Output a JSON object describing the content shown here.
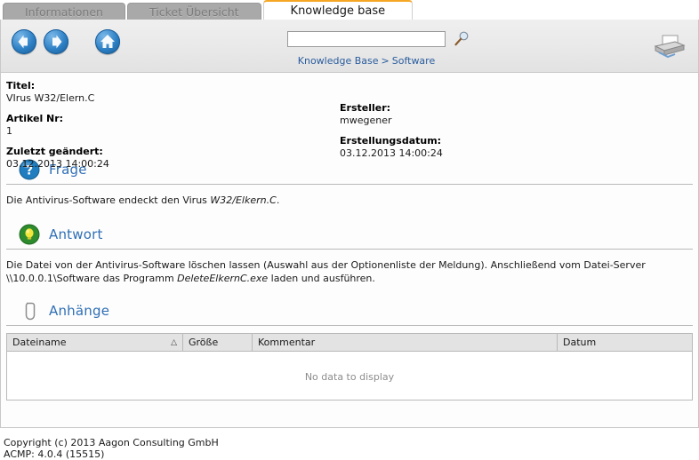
{
  "tabs": [
    {
      "label": "Informationen",
      "active": false
    },
    {
      "label": "Ticket Übersicht",
      "active": false
    },
    {
      "label": "Knowledge base",
      "active": true
    }
  ],
  "toolbar": {
    "back_label": "Zurück",
    "forward_label": "Vorwärts",
    "home_label": "Startseite",
    "print_label": "Drucken",
    "search_value": "",
    "search_placeholder": "",
    "search_button_label": "Suchen",
    "breadcrumb": {
      "root": "Knowledge Base",
      "separator": ">",
      "current": "Software"
    }
  },
  "meta": {
    "title_label": "Titel:",
    "title_value": "VIrus W32/Elern.C",
    "article_label": "Artikel Nr:",
    "article_value": "1",
    "modified_label": "Zuletzt geändert:",
    "modified_value": "03.12.2013 14:00:24",
    "creator_label": "Ersteller:",
    "creator_value": "mwegener",
    "created_label": "Erstellungsdatum:",
    "created_value": "03.12.2013 14:00:24"
  },
  "sections": {
    "question": {
      "icon": "question-mark-icon",
      "title": "Frage",
      "text_before": "Die Antivirus-Software endeckt den Virus ",
      "text_emphasis": "W32/Elkern.C",
      "text_after": "."
    },
    "answer": {
      "icon": "lightbulb-icon",
      "title": "Antwort",
      "text_before": "Die Datei von der Antivirus-Software löschen lassen (Auswahl aus der Optionenliste der Meldung). Anschließend vom Datei-Server \\\\10.0.0.1\\Software das Programm ",
      "text_emphasis": "DeleteElkernC.exe",
      "text_after": " laden und ausführen."
    },
    "attachments": {
      "icon": "paperclip-icon",
      "title": "Anhänge",
      "columns": [
        {
          "label": "Dateiname",
          "sorted": "asc",
          "sort_glyph": "△"
        },
        {
          "label": "Größe",
          "sorted": "",
          "sort_glyph": ""
        },
        {
          "label": "Kommentar",
          "sorted": "",
          "sort_glyph": ""
        },
        {
          "label": "Datum",
          "sorted": "",
          "sort_glyph": ""
        }
      ],
      "rows": [],
      "empty_message": "No data to display"
    }
  },
  "footer": {
    "copyright": "Copyright (c) 2013 Aagon Consulting GmbH",
    "version": "ACMP: 4.0.4 (15515)"
  },
  "colors": {
    "accent_blue": "#2f6fb5",
    "link_blue": "#2a5d9e",
    "active_tab_top": "#f5a623",
    "tab_inactive_bg": "#a9a9a9",
    "toolbar_bg": "#e8e8e8",
    "table_header_bg": "#e3e3e3"
  }
}
